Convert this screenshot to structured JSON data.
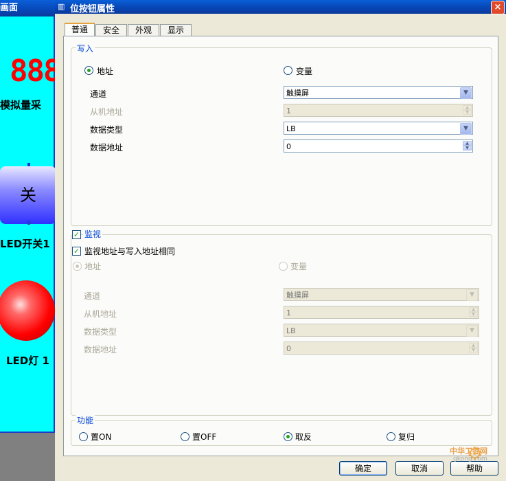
{
  "background": {
    "window_title": "画面",
    "digits": "888",
    "analog_label": "模拟量采",
    "switch_button_text": "关",
    "switch_label": "LED开关1",
    "lamp_label": "LED灯 1"
  },
  "dialog": {
    "title": "位按钮属性",
    "close_symbol": "×",
    "tabs": [
      "普通",
      "安全",
      "外观",
      "显示"
    ],
    "write_group": {
      "legend": "写入",
      "radio_address": "地址",
      "radio_variable": "变量",
      "channel_label": "通道",
      "channel_value": "触摸屏",
      "slave_label": "从机地址",
      "slave_value": "1",
      "type_label": "数据类型",
      "type_value": "LB",
      "addr_label": "数据地址",
      "addr_value": "0"
    },
    "monitor_group": {
      "legend": "监视",
      "same_address_label": "监视地址与写入地址相同",
      "radio_address": "地址",
      "radio_variable": "变量",
      "channel_label": "通道",
      "channel_value": "触摸屏",
      "slave_label": "从机地址",
      "slave_value": "1",
      "type_label": "数据类型",
      "type_value": "LB",
      "addr_label": "数据地址",
      "addr_value": "0"
    },
    "function_group": {
      "legend": "功能",
      "options": [
        "置ON",
        "置OFF",
        "取反",
        "复归"
      ],
      "selected": "取反"
    },
    "buttons": {
      "ok": "确定",
      "cancel": "取消",
      "help": "帮助"
    },
    "watermark": "中华工控网",
    "watermark_url": "gkong.com"
  },
  "colors": {
    "title_blue": "#0a5fd8",
    "canvas_cyan": "#00ffff",
    "legend_blue": "#0046d5",
    "radio_green": "#21a121"
  }
}
